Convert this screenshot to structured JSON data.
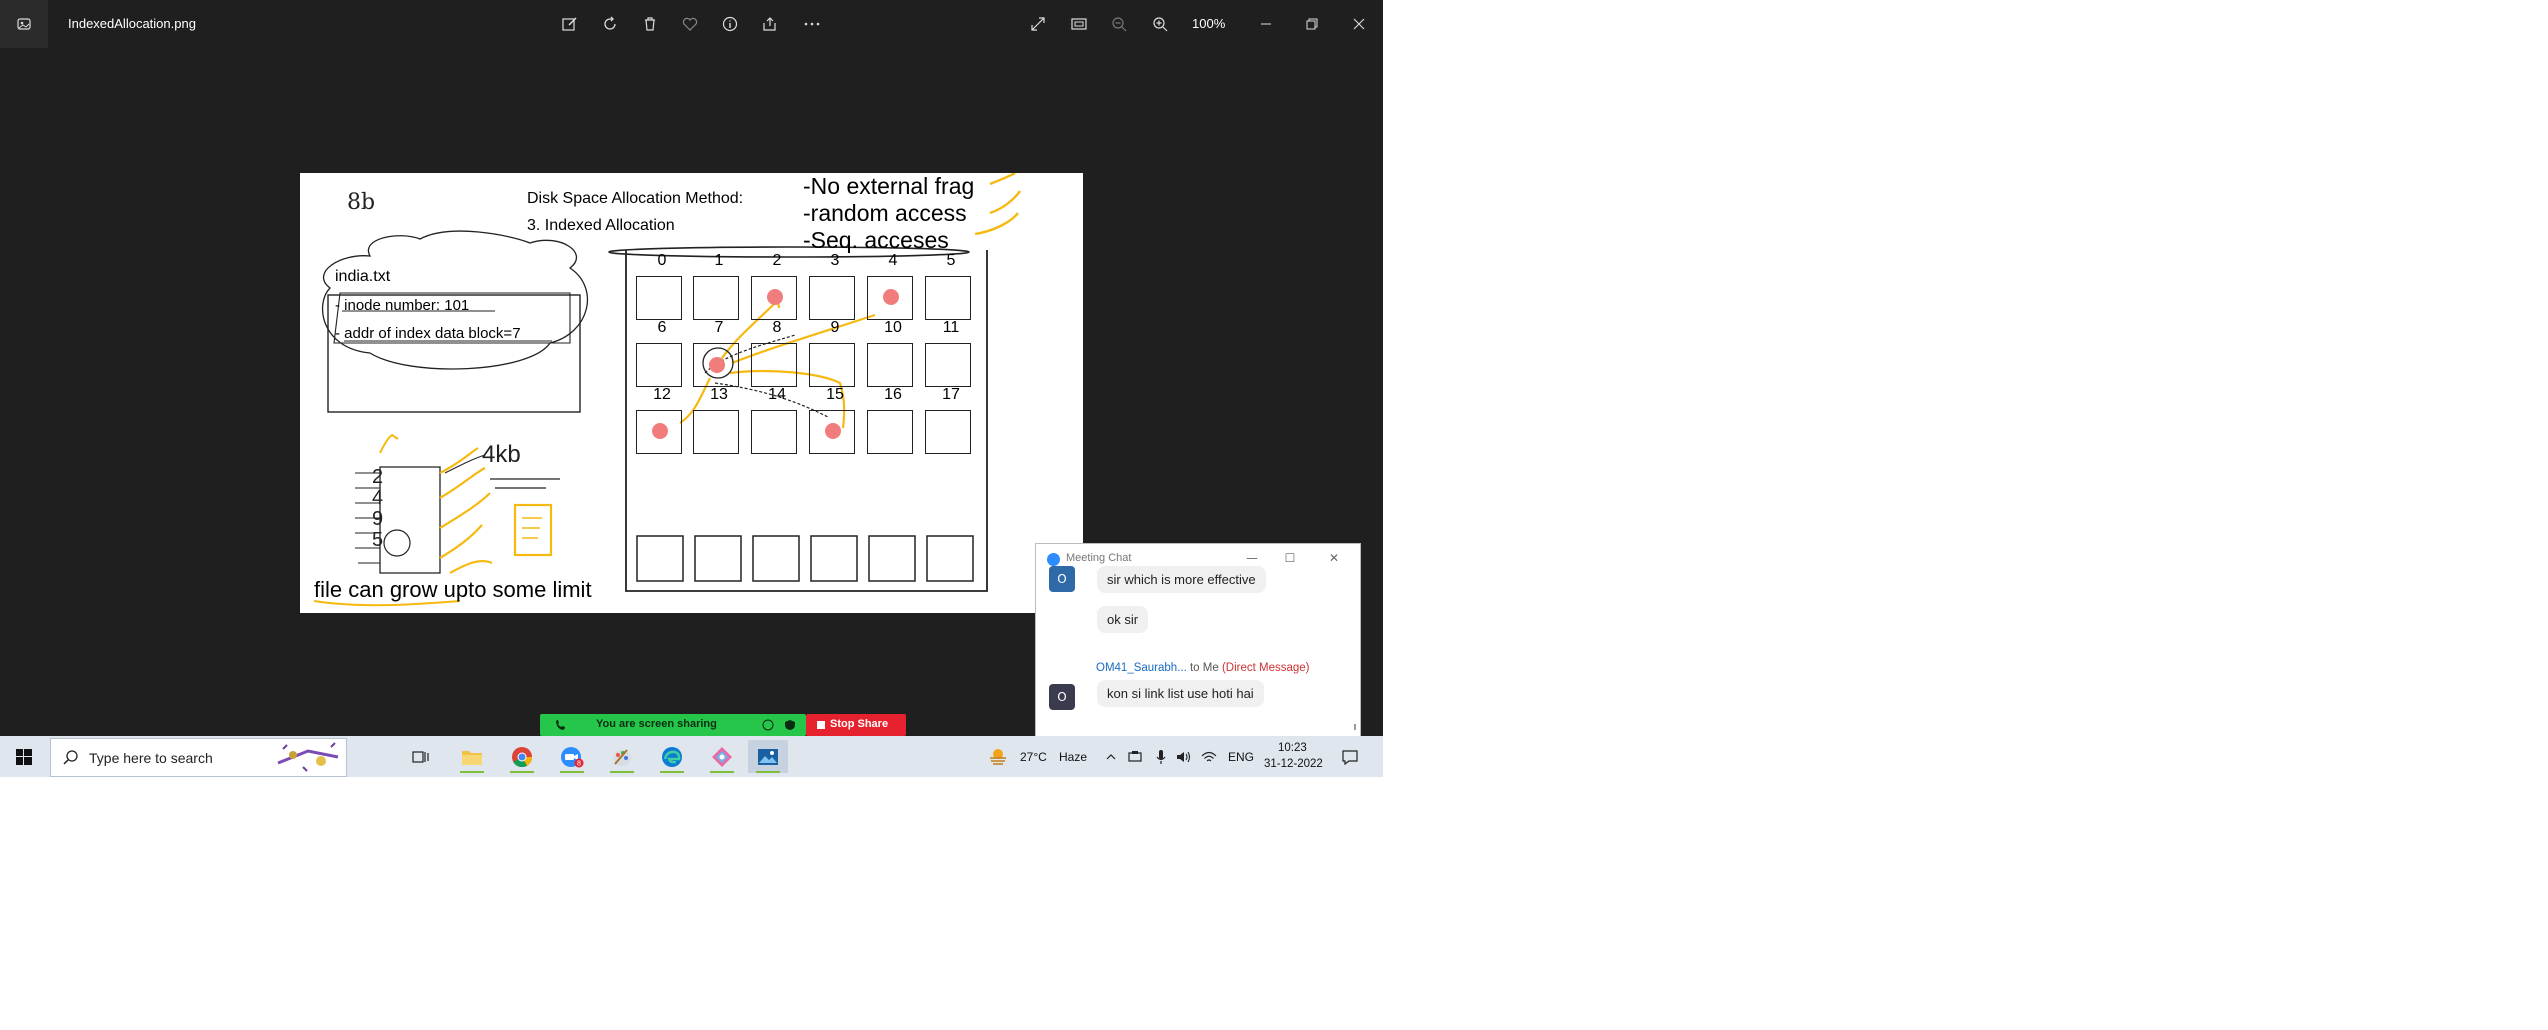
{
  "window": {
    "file_name": "IndexedAllocation.png",
    "zoom_level": "100%"
  },
  "board": {
    "title_line1": "Disk Space Allocation Method:",
    "title_line2": "3. Indexed Allocation",
    "corner_note": "8b",
    "file_name": "india.txt",
    "inode_line": "- inode number: 101",
    "addr_line": "- addr of index data block=7",
    "size_note": "4kb",
    "bottom_note": "file can grow upto some limit",
    "points": [
      "-No external frag",
      "-random access",
      "-Seq. acceses"
    ],
    "block_rows": [
      [
        "0",
        "1",
        "2",
        "3",
        "4",
        "5"
      ],
      [
        "6",
        "7",
        "8",
        "9",
        "10",
        "11"
      ],
      [
        "12",
        "13",
        "14",
        "15",
        "16",
        "17"
      ]
    ],
    "index_block_list": [
      "2",
      "4",
      "9",
      "5"
    ],
    "marked_blocks": [
      "2",
      "4",
      "7",
      "12",
      "15"
    ]
  },
  "chat": {
    "title": "Meeting Chat",
    "messages": [
      {
        "avatar": "O",
        "text": "sir which is more effective"
      },
      {
        "text": "ok sir"
      },
      {
        "sender": "OM41_Saurabh...",
        "to": "to Me",
        "tag": "(Direct Message)",
        "avatar": "O",
        "text": "kon si link list use hoti hai"
      }
    ]
  },
  "share_bar": {
    "label": "You are screen sharing",
    "stop_label": "Stop Share"
  },
  "taskbar": {
    "search_placeholder": "Type here to search",
    "weather_temp": "27°C",
    "weather_desc": "Haze",
    "language": "ENG",
    "time": "10:23",
    "date": "31-12-2022"
  },
  "colors": {
    "app_bg": "#1f1f1f",
    "marker_yellow": "#f6b911",
    "dot_red": "#f17c7c",
    "share_green": "#26c64b",
    "stop_red": "#e5222d"
  }
}
